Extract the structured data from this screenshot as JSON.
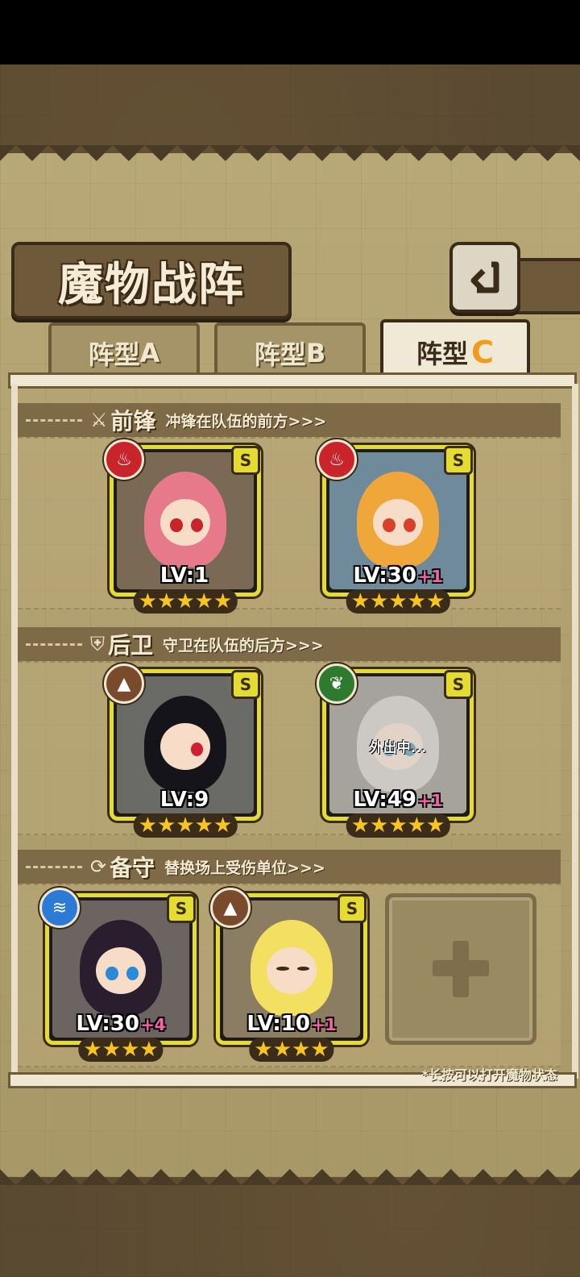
{
  "title": "魔物战阵",
  "back_button": {
    "icon": "back-arrow-icon"
  },
  "tabs": [
    {
      "label": "阵型",
      "suffix": "A",
      "active": false
    },
    {
      "label": "阵型",
      "suffix": "B",
      "active": false
    },
    {
      "label": "阵型",
      "suffix": "C",
      "active": true
    }
  ],
  "sections": {
    "front": {
      "name": "前锋",
      "desc": "冲锋在队伍的前方>>>",
      "icon": "sword-icon"
    },
    "back": {
      "name": "后卫",
      "desc": "守卫在队伍的后方>>>",
      "icon": "shield-icon"
    },
    "reserve": {
      "name": "备守",
      "desc": "替换场上受伤单位>>>",
      "icon": "swap-icon"
    }
  },
  "cards": {
    "front_1": {
      "rank": "S",
      "element": "fire-icon",
      "level": "LV:1",
      "bonus": "",
      "stars": "★★★★★"
    },
    "front_2": {
      "rank": "S",
      "element": "fire-icon",
      "level": "LV:30",
      "bonus": "+1",
      "stars": "★★★★★"
    },
    "back_1": {
      "rank": "S",
      "element": "earth-icon",
      "level": "LV:9",
      "bonus": "",
      "stars": "★★★★★"
    },
    "back_2": {
      "rank": "S",
      "element": "leaf-icon",
      "level": "LV:49",
      "bonus": "+1",
      "stars": "★★★★★",
      "status": "外出中..."
    },
    "reserve_1": {
      "rank": "S",
      "element": "water-icon",
      "level": "LV:30",
      "bonus": "+4",
      "stars": "★★★★"
    },
    "reserve_2": {
      "rank": "S",
      "element": "earth-icon",
      "level": "LV:10",
      "bonus": "+1",
      "stars": "★★★★"
    }
  },
  "hint": "*长按可以打开魔物状态",
  "colors": {
    "frame_yellow": "#e4dc32",
    "fire": "#c8242a",
    "earth": "#7a4a2c",
    "leaf": "#2e7a2e",
    "water": "#2a7ad6",
    "star": "#f8c520",
    "bonus": "#ff5fa8"
  }
}
